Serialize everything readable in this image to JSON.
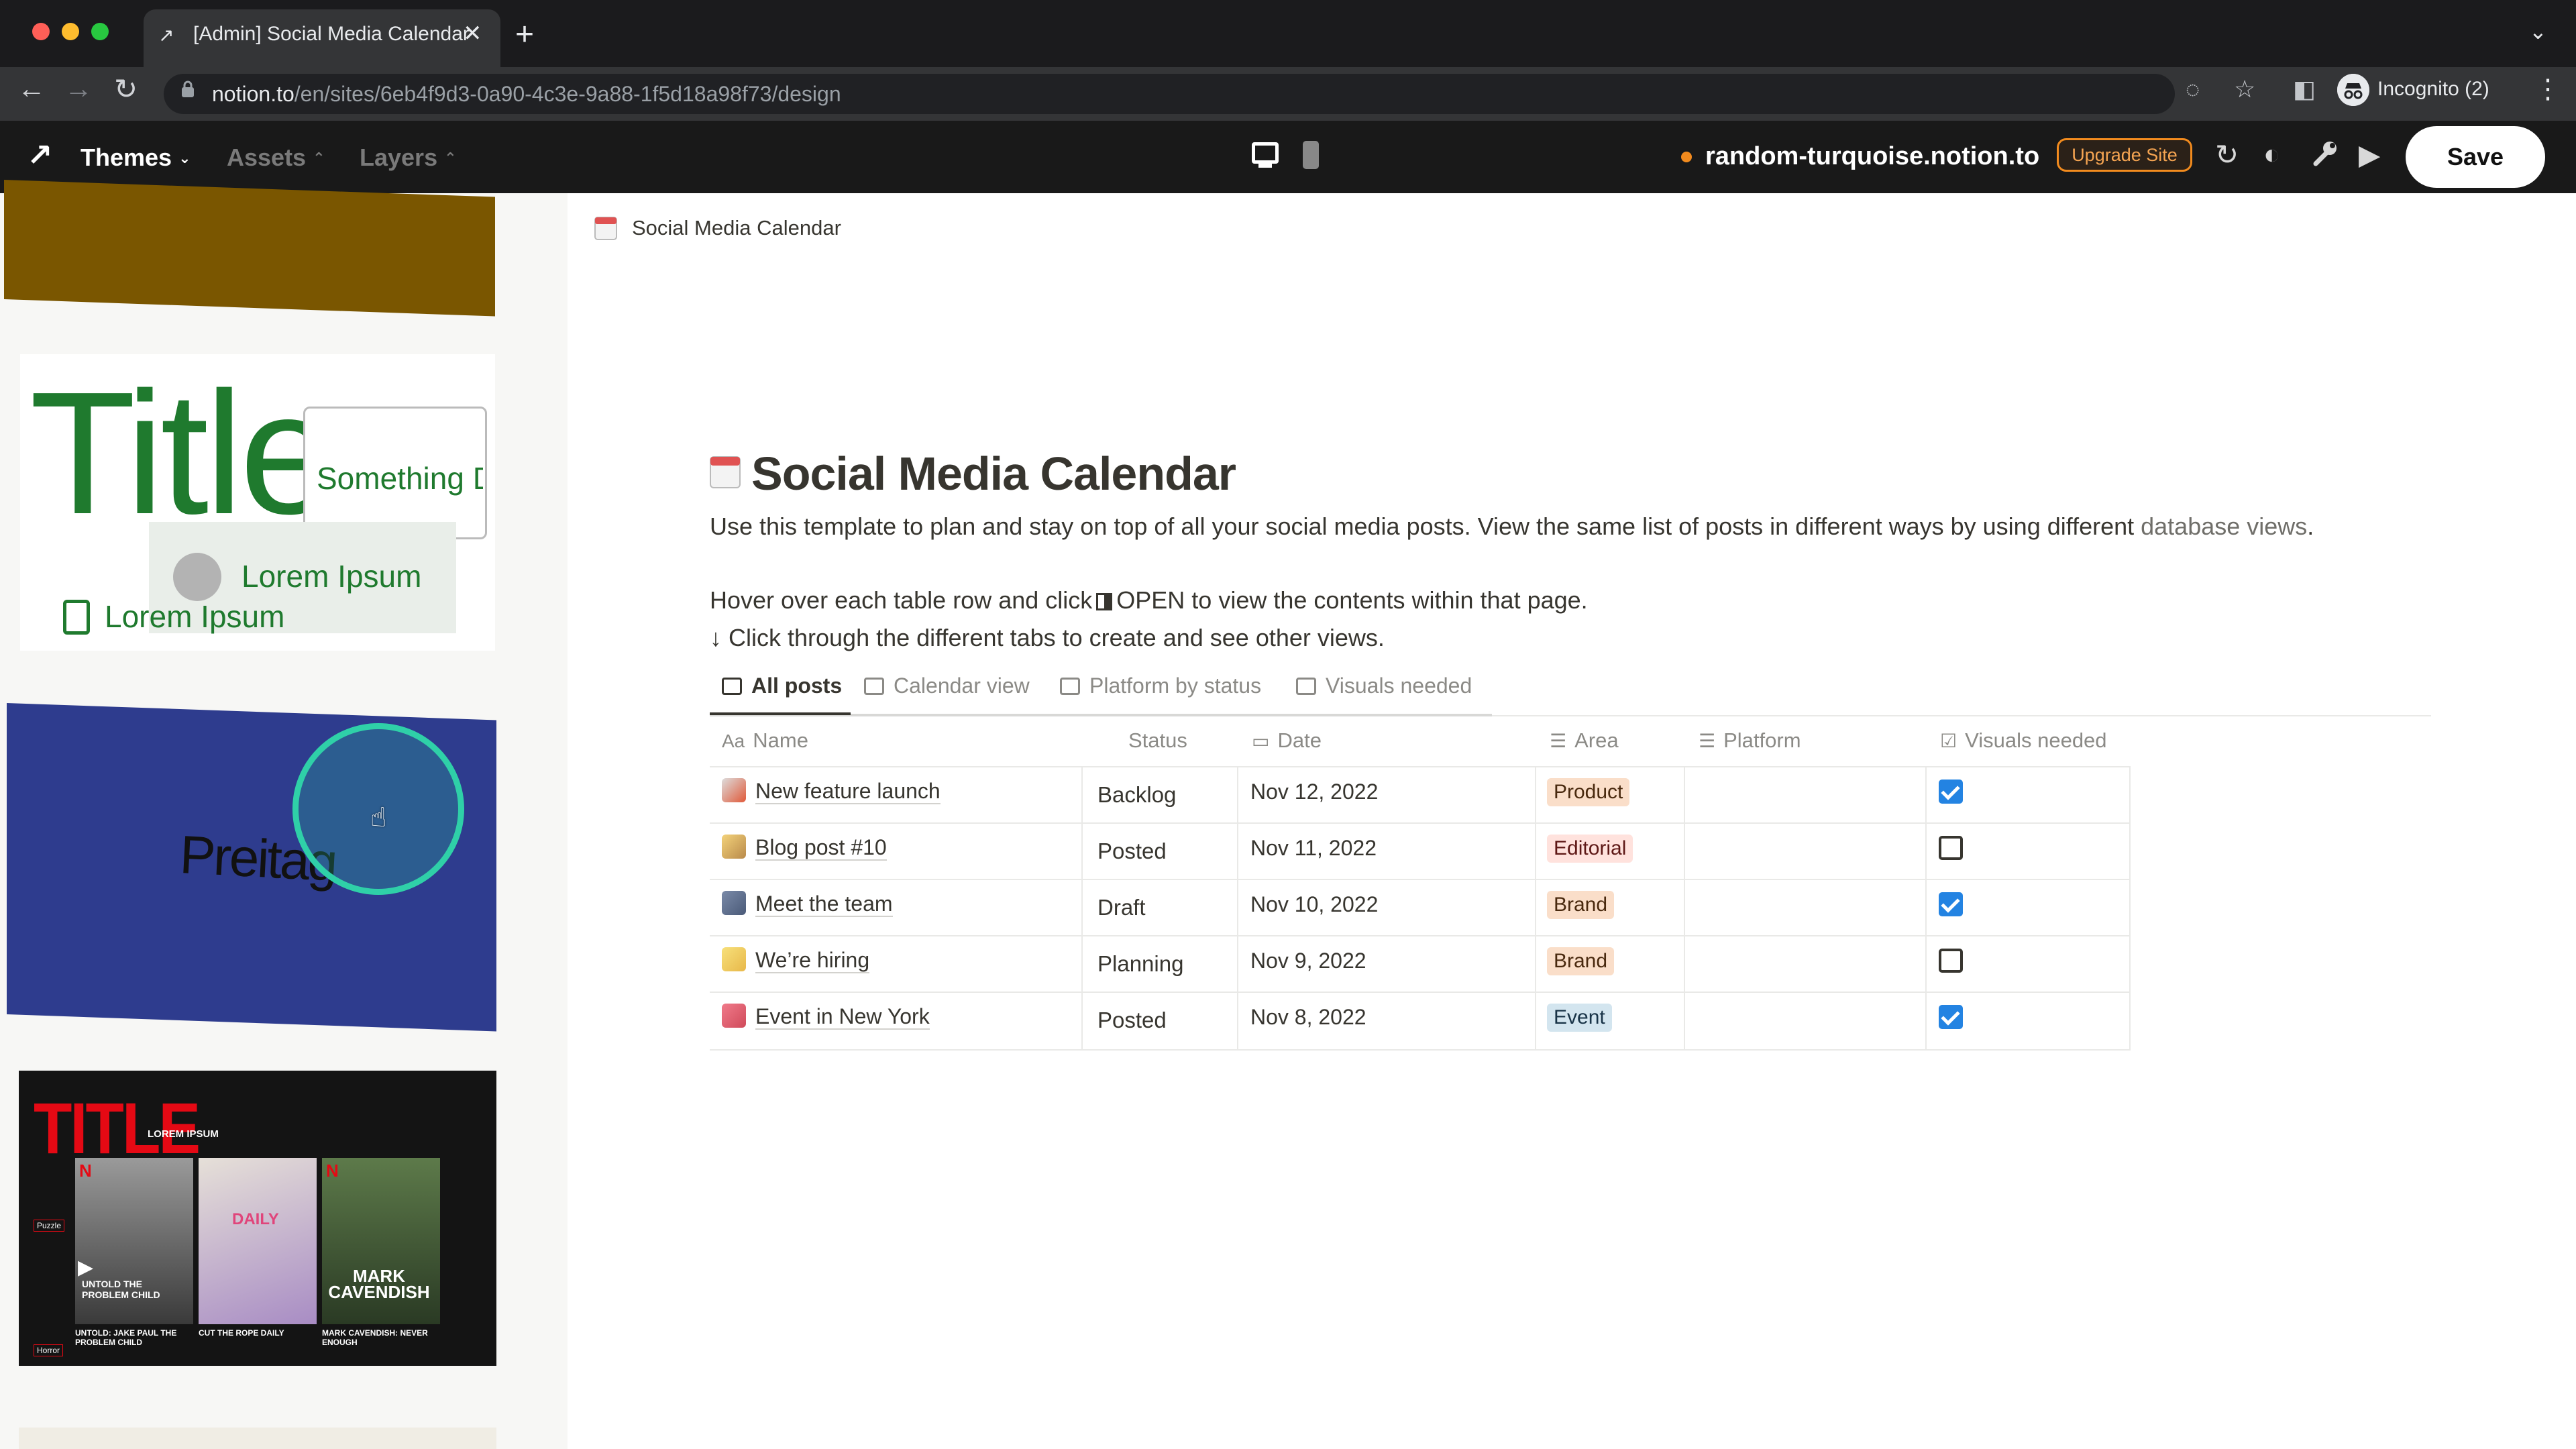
{
  "browser": {
    "tab_title": "[Admin] Social Media Calendar",
    "url_host": "notion.to",
    "url_path": "/en/sites/6eb4f9d3-0a90-4c3e-9a88-1f5d18a98f73/design",
    "profile_label": "Incognito (2)"
  },
  "toolbar": {
    "menus": [
      "Themes",
      "Assets",
      "Layers"
    ],
    "site_domain": "random-turquoise.notion.to",
    "upgrade_label": "Upgrade Site",
    "save_label": "Save",
    "accent_color": "#f28b1e"
  },
  "themes": {
    "title_card": {
      "title": "Title",
      "box_text": "Something Delicious",
      "pill_text": "Lorem Ipsum",
      "doc_text": "Lorem Ipsum"
    },
    "blue_card": {
      "text": "Preitag"
    },
    "dark_card": {
      "title": "TITLE",
      "subtitle": "LOREM IPSUM",
      "posters": [
        {
          "title": "UNTOLD THE PROBLEM CHILD",
          "caption": "UNTOLD: JAKE PAUL THE PROBLEM CHILD"
        },
        {
          "title": "DAILY",
          "caption": "CUT THE ROPE DAILY"
        },
        {
          "title": "MARK CAVENDISH",
          "caption": "MARK CAVENDISH: NEVER ENOUGH"
        }
      ],
      "side_tags": [
        "Puzzle",
        "Horror"
      ]
    }
  },
  "page": {
    "breadcrumb": "Social Media Calendar",
    "title": "Social Media Calendar",
    "description_prefix": "Use this template to plan and stay on top of all your social media posts. View the same list of posts in different ways by using different ",
    "description_link": "database views",
    "description_suffix": ".",
    "hint1_prefix": "Hover over each table row and click",
    "hint1_suffix": "OPEN to view the contents within that page.",
    "hint2": "↓ Click through the different tabs to create and see other views.",
    "tabs": [
      "All posts",
      "Calendar view",
      "Platform by status",
      "Visuals needed"
    ],
    "columns": [
      "Name",
      "Status",
      "Date",
      "Area",
      "Platform",
      "Visuals needed"
    ],
    "rows": [
      {
        "name": "New feature launch",
        "status": "Backlog",
        "date": "Nov 12, 2022",
        "area": "Product",
        "visuals": true
      },
      {
        "name": "Blog post #10",
        "status": "Posted",
        "date": "Nov 11, 2022",
        "area": "Editorial",
        "visuals": false
      },
      {
        "name": "Meet the team",
        "status": "Draft",
        "date": "Nov 10, 2022",
        "area": "Brand",
        "visuals": true
      },
      {
        "name": "We’re hiring",
        "status": "Planning",
        "date": "Nov 9, 2022",
        "area": "Brand",
        "visuals": false
      },
      {
        "name": "Event in New York",
        "status": "Posted",
        "date": "Nov 8, 2022",
        "area": "Event",
        "visuals": true
      }
    ],
    "tag_colors": {
      "Product": "#fadec9",
      "Editorial": "#ffe2dd",
      "Brand": "#fadec9",
      "Event": "#d3e5ef"
    }
  }
}
